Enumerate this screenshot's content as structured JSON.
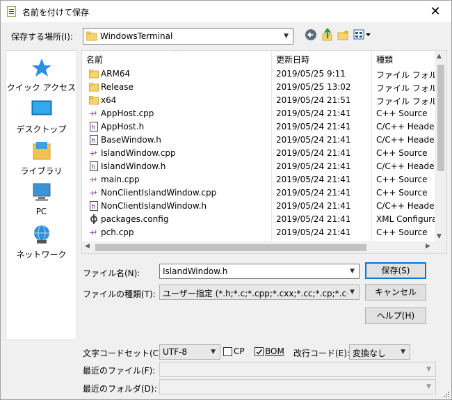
{
  "window": {
    "title": "名前を付けて保存",
    "close_glyph": "✕"
  },
  "location": {
    "label": "保存する場所(I):",
    "value": "WindowsTerminal"
  },
  "toolbar": {
    "back_glyph": "◀",
    "up_glyph": "↑",
    "newfolder_glyph": "✱",
    "view_glyph": "▦▾"
  },
  "places": [
    {
      "label": "クイック アクセス",
      "icon": "star-icon"
    },
    {
      "label": "デスクトップ",
      "icon": "desktop-icon"
    },
    {
      "label": "ライブラリ",
      "icon": "library-icon"
    },
    {
      "label": "PC",
      "icon": "pc-icon"
    },
    {
      "label": "ネットワーク",
      "icon": "network-icon"
    }
  ],
  "columns": {
    "name": "名前",
    "modified": "更新日時",
    "type": "種類",
    "sort_glyph": "^"
  },
  "files": [
    {
      "name": "ARM64",
      "modified": "2019/05/25 9:11",
      "type": "ファイル フォルダー",
      "icon": "folder"
    },
    {
      "name": "Release",
      "modified": "2019/05/25 13:02",
      "type": "ファイル フォルダー",
      "icon": "folder"
    },
    {
      "name": "x64",
      "modified": "2019/05/24 21:51",
      "type": "ファイル フォルダー",
      "icon": "folder"
    },
    {
      "name": "AppHost.cpp",
      "modified": "2019/05/24 21:41",
      "type": "C++ Source",
      "icon": "cpp"
    },
    {
      "name": "AppHost.h",
      "modified": "2019/05/24 21:41",
      "type": "C/C++ Header",
      "icon": "h"
    },
    {
      "name": "BaseWindow.h",
      "modified": "2019/05/24 21:41",
      "type": "C/C++ Header",
      "icon": "h"
    },
    {
      "name": "IslandWindow.cpp",
      "modified": "2019/05/24 21:41",
      "type": "C++ Source",
      "icon": "cpp"
    },
    {
      "name": "IslandWindow.h",
      "modified": "2019/05/24 21:41",
      "type": "C/C++ Header",
      "icon": "h"
    },
    {
      "name": "main.cpp",
      "modified": "2019/05/24 21:41",
      "type": "C++ Source",
      "icon": "cpp"
    },
    {
      "name": "NonClientIslandWindow.cpp",
      "modified": "2019/05/24 21:41",
      "type": "C++ Source",
      "icon": "cpp"
    },
    {
      "name": "NonClientIslandWindow.h",
      "modified": "2019/05/24 21:41",
      "type": "C/C++ Header",
      "icon": "h"
    },
    {
      "name": "packages.config",
      "modified": "2019/05/24 21:41",
      "type": "XML Configurati",
      "icon": "config"
    },
    {
      "name": "pch.cpp",
      "modified": "2019/05/24 21:41",
      "type": "C++ Source",
      "icon": "cpp"
    }
  ],
  "filename": {
    "label": "ファイル名(N):",
    "value": "IslandWindow.h"
  },
  "filetype": {
    "label": "ファイルの種類(T):",
    "value": "ユーザー指定 (*.h;*.c;*.cpp;*.cxx;*.cc;*.cp;*.c++;*.hp"
  },
  "buttons": {
    "save": "保存(S)",
    "cancel": "キャンセル",
    "help": "ヘルプ(H)"
  },
  "encoding": {
    "label": "文字コードセット(C):",
    "value": "UTF-8",
    "cp_label": "CP",
    "bom_label": "BOM",
    "bom_checked": true,
    "cp_checked": false,
    "newline_label": "改行コード(E):",
    "newline_value": "変換なし"
  },
  "recent_files": {
    "label": "最近のファイル(F):",
    "value": ""
  },
  "recent_folders": {
    "label": "最近のフォルダ(D):",
    "value": ""
  }
}
